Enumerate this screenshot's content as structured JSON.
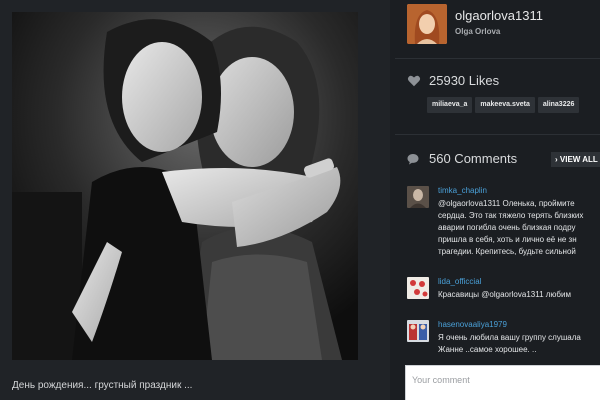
{
  "post": {
    "caption": "День рождения... грустный праздник ..."
  },
  "profile": {
    "username": "olgaorlova1311",
    "full_name": "Olga Orlova",
    "avatar_icon": "profile-avatar"
  },
  "likes": {
    "count_text": "25930 Likes",
    "icon": "heart-icon",
    "likers": [
      "miliaeva_a",
      "makeeva.sveta",
      "alina3226"
    ]
  },
  "comments": {
    "count_text": "560 Comments",
    "view_all_label": "› VIEW ALL",
    "icon": "comment-icon",
    "items": [
      {
        "user": "timka_chaplin",
        "text": "@olgaorlova1311 Оленька, проймите\nсердца. Это так тяжело терять близких\nаварии погибла очень близкая подру\nпришла в себя, хоть и лично её не зн\nтрагедии. Крепитесь, будьте сильной"
      },
      {
        "user": "lida_officcial",
        "text": "Красавицы @olgaorlova1311 любим"
      },
      {
        "user": "hasenovaaliya1979",
        "text": "Я очень любила вашу группу слушала\nЖанне ..самое хорошее. .."
      }
    ]
  },
  "comment_input": {
    "placeholder": "Your comment"
  },
  "colors": {
    "background": "#1b1e22",
    "link": "#4aa0d8",
    "tag_bg": "#2e3237"
  }
}
